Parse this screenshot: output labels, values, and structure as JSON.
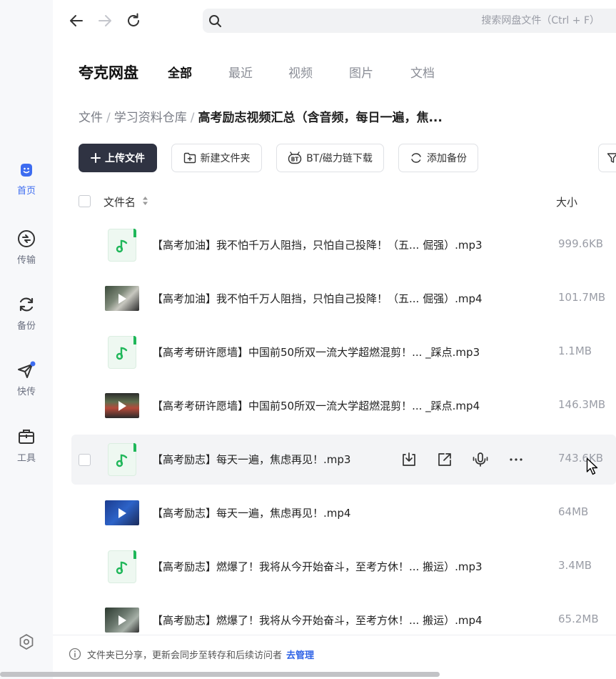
{
  "sidebar": {
    "items": [
      {
        "label": "首页",
        "icon": "home-icon",
        "active": true
      },
      {
        "label": "传输",
        "icon": "transfer-icon"
      },
      {
        "label": "备份",
        "icon": "backup-icon"
      },
      {
        "label": "快传",
        "icon": "quick-send-icon"
      },
      {
        "label": "工具",
        "icon": "toolbox-icon"
      }
    ],
    "settings_icon": "settings-icon"
  },
  "topbar": {
    "search_placeholder": "搜索网盘文件（Ctrl + F）"
  },
  "header": {
    "brand": "夸克网盘",
    "tabs": [
      {
        "label": "全部",
        "active": true
      },
      {
        "label": "最近"
      },
      {
        "label": "视频"
      },
      {
        "label": "图片"
      },
      {
        "label": "文档"
      }
    ]
  },
  "breadcrumb": {
    "items": [
      "文件",
      "学习资料仓库"
    ],
    "current": "高考励志视频汇总（含音频，每日一遍，焦..."
  },
  "toolbar": {
    "upload": "上传文件",
    "new_folder": "新建文件夹",
    "bt_download": "BT/磁力链下载",
    "add_backup": "添加备份"
  },
  "table": {
    "col_name": "文件名",
    "col_size": "大小",
    "rows": [
      {
        "type": "audio",
        "name": "【高考加油】我不怕千万人阻挡，只怕自己投降！（五...  倔强）.mp3",
        "size": "999.6KB"
      },
      {
        "type": "video",
        "name": "【高考加油】我不怕千万人阻挡，只怕自己投降！（五...  倔强）.mp4",
        "size": "101.7MB"
      },
      {
        "type": "audio",
        "name": "【高考考研许愿墙】中国前50所双一流大学超燃混剪！...  _踩点.mp3",
        "size": "1.1MB"
      },
      {
        "type": "video",
        "name": "【高考考研许愿墙】中国前50所双一流大学超燃混剪！...  _踩点.mp4",
        "size": "146.3MB"
      },
      {
        "type": "audio",
        "name": "【高考励志】每天一遍，焦虑再见！.mp3",
        "size": "743.6KB",
        "hover": true
      },
      {
        "type": "video",
        "name": "【高考励志】每天一遍，焦虑再见！.mp4",
        "size": "64MB"
      },
      {
        "type": "audio",
        "name": "【高考励志】燃爆了！我将从今开始奋斗，至考方休！...  搬运）.mp3",
        "size": "3.4MB"
      },
      {
        "type": "video",
        "name": "【高考励志】燃爆了！我将从今开始奋斗，至考方休！...  搬运）.mp4",
        "size": "65.2MB"
      }
    ]
  },
  "notice": {
    "text": "文件夹已分享，更新会同步至转存和后续访问者",
    "link": "去管理"
  },
  "colors": {
    "accent": "#3d6cf0",
    "audio_green": "#20b75a",
    "primary_button": "#2f3342"
  }
}
